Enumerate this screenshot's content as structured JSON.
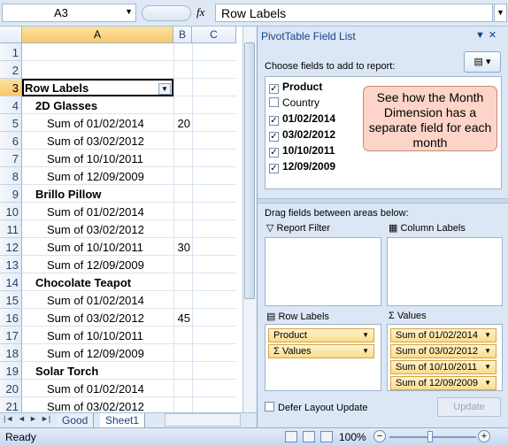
{
  "formula_bar": {
    "name_box": "A3",
    "fx": "fx",
    "content": "Row Labels"
  },
  "columns": [
    "A",
    "B",
    "C"
  ],
  "rows": [
    {
      "num": "1",
      "a": "",
      "b": "",
      "style": ""
    },
    {
      "num": "2",
      "a": "",
      "b": "",
      "style": ""
    },
    {
      "num": "3",
      "a": "Row Labels",
      "b": "",
      "style": "header"
    },
    {
      "num": "4",
      "a": "2D Glasses",
      "b": "",
      "style": "group"
    },
    {
      "num": "5",
      "a": "Sum of 01/02/2014",
      "b": "20",
      "style": "item"
    },
    {
      "num": "6",
      "a": "Sum of 03/02/2012",
      "b": "",
      "style": "item"
    },
    {
      "num": "7",
      "a": "Sum of 10/10/2011",
      "b": "",
      "style": "item"
    },
    {
      "num": "8",
      "a": "Sum of 12/09/2009",
      "b": "",
      "style": "item"
    },
    {
      "num": "9",
      "a": "Brillo Pillow",
      "b": "",
      "style": "group"
    },
    {
      "num": "10",
      "a": "Sum of 01/02/2014",
      "b": "",
      "style": "item"
    },
    {
      "num": "11",
      "a": "Sum of 03/02/2012",
      "b": "",
      "style": "item"
    },
    {
      "num": "12",
      "a": "Sum of 10/10/2011",
      "b": "30",
      "style": "item"
    },
    {
      "num": "13",
      "a": "Sum of 12/09/2009",
      "b": "",
      "style": "item"
    },
    {
      "num": "14",
      "a": "Chocolate Teapot",
      "b": "",
      "style": "group"
    },
    {
      "num": "15",
      "a": "Sum of 01/02/2014",
      "b": "",
      "style": "item"
    },
    {
      "num": "16",
      "a": "Sum of 03/02/2012",
      "b": "45",
      "style": "item"
    },
    {
      "num": "17",
      "a": "Sum of 10/10/2011",
      "b": "",
      "style": "item"
    },
    {
      "num": "18",
      "a": "Sum of 12/09/2009",
      "b": "",
      "style": "item"
    },
    {
      "num": "19",
      "a": "Solar Torch",
      "b": "",
      "style": "group"
    },
    {
      "num": "20",
      "a": "Sum of 01/02/2014",
      "b": "",
      "style": "item"
    },
    {
      "num": "21",
      "a": "Sum of 03/02/2012",
      "b": "",
      "style": "item"
    }
  ],
  "sheet_tabs": [
    "Good",
    "Sheet1"
  ],
  "pivot_pane": {
    "title": "PivotTable Field List",
    "choose_label": "Choose fields to add to report:",
    "fields": [
      {
        "label": "Product",
        "checked": true,
        "bold": true
      },
      {
        "label": "Country",
        "checked": false,
        "bold": false
      },
      {
        "label": "01/02/2014",
        "checked": true,
        "bold": true
      },
      {
        "label": "03/02/2012",
        "checked": true,
        "bold": true
      },
      {
        "label": "10/10/2011",
        "checked": true,
        "bold": true
      },
      {
        "label": "12/09/2009",
        "checked": true,
        "bold": true
      }
    ],
    "callout": "See how the Month Dimension has a separate field for each month",
    "drag_label": "Drag fields between areas below:",
    "report_filter_label": "Report Filter",
    "column_labels_label": "Column Labels",
    "row_labels_label": "Row Labels",
    "values_label": "Values",
    "row_chips": [
      "Product",
      "Σ Values"
    ],
    "value_chips": [
      "Sum of 01/02/2014",
      "Sum of 03/02/2012",
      "Sum of 10/10/2011",
      "Sum of 12/09/2009"
    ],
    "defer_label": "Defer Layout Update",
    "update_label": "Update"
  },
  "status": {
    "ready": "Ready",
    "zoom": "100%"
  }
}
